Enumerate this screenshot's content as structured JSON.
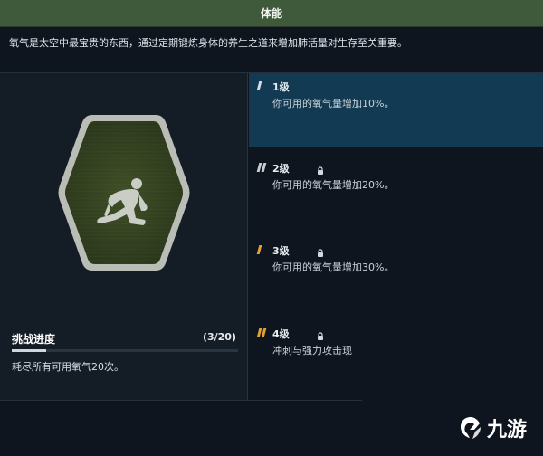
{
  "header": {
    "title": "体能"
  },
  "description": "氧气是太空中最宝贵的东西，通过定期锻炼身体的养生之道来增加肺活量对生存至关重要。",
  "badge": {
    "icon": "sprinter-icon",
    "frame_color": "#b9bdb6",
    "fill_color": "#33401f"
  },
  "progress": {
    "title": "挑战进度",
    "count": "(3/20)",
    "fraction": 0.15,
    "description": "耗尽所有可用氧气20次。"
  },
  "levels": [
    {
      "name": "1级",
      "text": "你可用的氧气量增加10%。",
      "locked": false,
      "active": true,
      "marker_color": "#d8dde2",
      "marker_bars": 1
    },
    {
      "name": "2级",
      "text": "你可用的氧气量增加20%。",
      "locked": true,
      "active": false,
      "marker_color": "#c7ccd1",
      "marker_bars": 2
    },
    {
      "name": "3级",
      "text": "你可用的氧气量增加30%。",
      "locked": true,
      "active": false,
      "marker_color": "#e0a233",
      "marker_bars": 1
    },
    {
      "name": "4级",
      "text": "冲刺与强力攻击现",
      "locked": true,
      "active": false,
      "marker_color": "#e0a233",
      "marker_bars": 2
    }
  ],
  "watermark": {
    "text": "九游",
    "icon": "jiuyou-logo-icon"
  }
}
